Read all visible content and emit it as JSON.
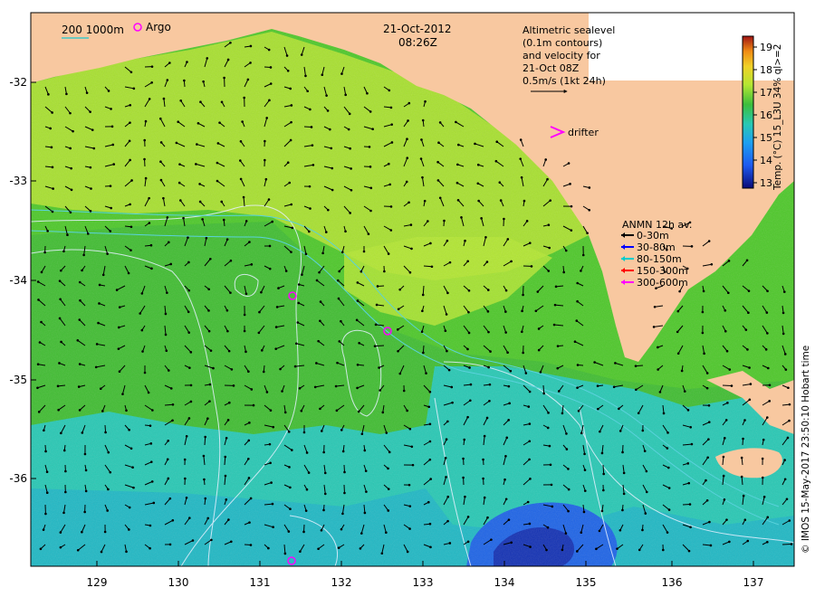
{
  "map": {
    "date": "21-Oct-2012",
    "time": "08:26Z",
    "argo_label": "Argo",
    "scale_label": "200  1000m",
    "altimetry_note": [
      "Altimetric sealevel",
      "(0.1m contours)",
      "and velocity for",
      "21-Oct 08Z",
      "0.5m/s (1kt 24h)"
    ],
    "drifter_label": "drifter",
    "anmn": {
      "title": "ANMN 12h av.",
      "items": [
        {
          "label": "0-30m",
          "color": "#000000"
        },
        {
          "label": "30-80m",
          "color": "#0000ff"
        },
        {
          "label": "80-150m",
          "color": "#00cccc"
        },
        {
          "label": "150-300m",
          "color": "#ff0000"
        },
        {
          "label": "300-600m",
          "color": "#ff00ff"
        }
      ]
    },
    "colorbar": {
      "label": "Temp. (°C) 15_L3U 34% ql>=2",
      "ticks": [
        "13",
        "14",
        "15",
        "16",
        "17",
        "18",
        "19"
      ]
    },
    "x_ticks": [
      "129",
      "130",
      "131",
      "132",
      "133",
      "134",
      "135",
      "136",
      "137"
    ],
    "y_ticks": [
      "-32",
      "-33",
      "-34",
      "-35",
      "-36"
    ],
    "credit": "© IMOS 15-May-2017 23:50:10 Hobart time",
    "colors": {
      "land": "#f8c8a0",
      "sst_green": "#4ec82a",
      "sst_yellow": "#b4e632",
      "sst_cyan": "#28c8b4",
      "sst_blue": "#1e64e6",
      "argo": "#ff00ff"
    }
  }
}
